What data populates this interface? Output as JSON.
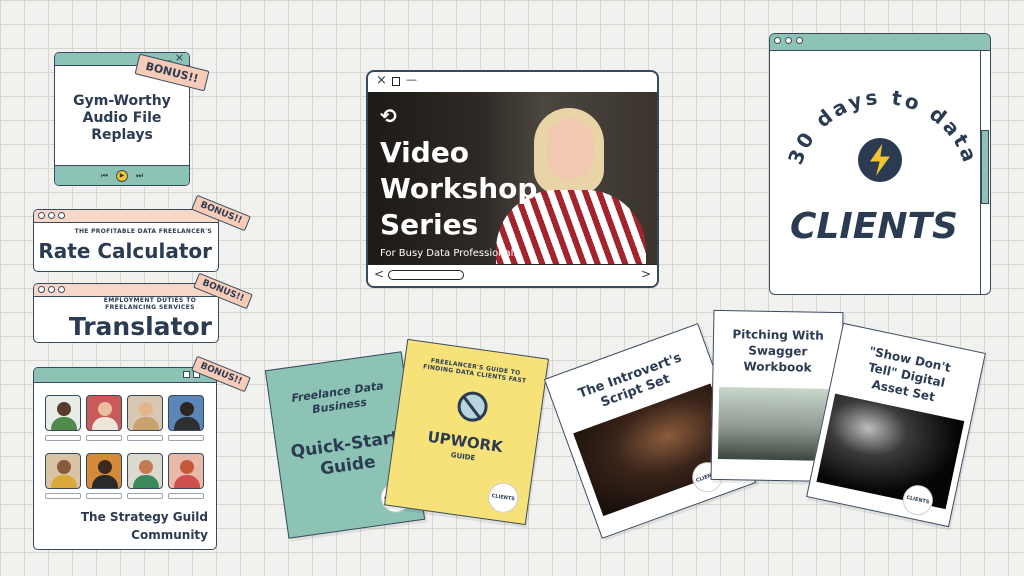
{
  "audio_window": {
    "badge": "BONUS!!",
    "title": "Gym-Worthy Audio File Replays",
    "controls": [
      "previous-icon",
      "play-icon",
      "next-icon"
    ]
  },
  "rate_window": {
    "badge": "BONUS!!",
    "overline": "THE PROFITABLE DATA FREELANCER'S",
    "title": "Rate Calculator"
  },
  "translator_window": {
    "badge": "BONUS!!",
    "overline": "EMPLOYMENT DUTIES TO FREELANCING SERVICES",
    "title": "Translator"
  },
  "guild_window": {
    "badge": "BONUS!!",
    "title_line1": "The Strategy Guild",
    "title_line2": "Community"
  },
  "video_window": {
    "title_line1": "Video",
    "title_line2": "Workshop",
    "title_line3": "Series",
    "subtitle": "For Busy Data Professionals",
    "icon": "repeat-icon"
  },
  "clients_window": {
    "arc_text": "30 days to data",
    "headline": "CLIENTS",
    "icon": "lightning-bolt-icon"
  },
  "quickstart_doc": {
    "line1": "Freelance Data",
    "line2": "Business",
    "title1": "Quick-Start",
    "title2": "Guide"
  },
  "upwork_doc": {
    "arc_text": "FREELANCER'S GUIDE TO FINDING DATA CLIENTS FAST",
    "title": "UPWORK",
    "subtitle": "GUIDE"
  },
  "introvert_doc": {
    "title1": "The Introvert's",
    "title2": "Script Set"
  },
  "pitching_doc": {
    "title1": "Pitching With",
    "title2": "Swagger",
    "title3": "Workbook"
  },
  "asset_doc": {
    "title1": "\"Show Don't",
    "title2": "Tell\" Digital",
    "title3": "Asset Set"
  },
  "colors": {
    "navy": "#2b3b52",
    "teal": "#8dc3b5",
    "peach": "#f6cbb8",
    "yellow": "#f7e27a",
    "lightning": "#f4c430"
  }
}
